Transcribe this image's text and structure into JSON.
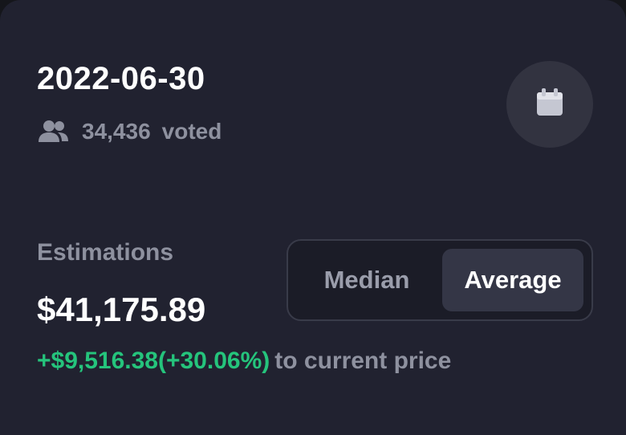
{
  "prediction": {
    "date": "2022-06-30",
    "voters_count": "34,436",
    "voters_label": "voted"
  },
  "calendar_button": {
    "icon": "calendar-icon"
  },
  "estimations": {
    "label": "Estimations",
    "value": "$41,175.89",
    "change": "+$9,516.38(+30.06%)",
    "change_suffix": "to current price",
    "change_color": "#25c47c"
  },
  "toggle": {
    "options": [
      "Median",
      "Average"
    ],
    "selected": "Average"
  },
  "colors": {
    "card_bg": "#212230",
    "accent_green": "#25c47c",
    "muted_text": "#8e919f"
  },
  "icons": {
    "voters": "users-icon",
    "calendar": "calendar-icon"
  }
}
